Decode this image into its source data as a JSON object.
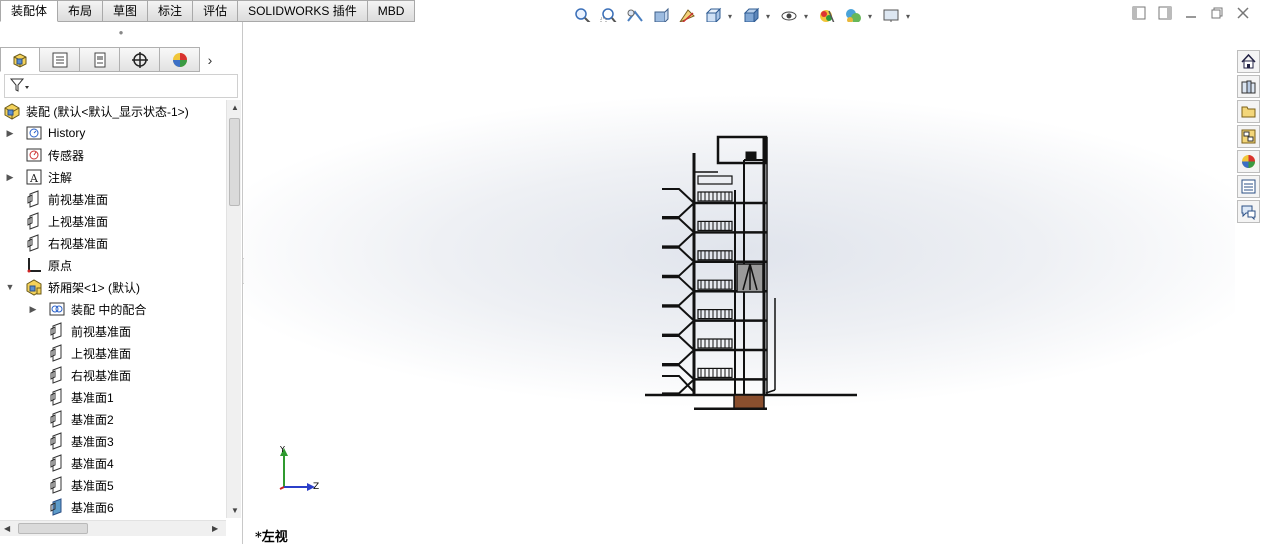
{
  "command_tabs": [
    {
      "label": "装配体",
      "active": true
    },
    {
      "label": "布局",
      "active": false
    },
    {
      "label": "草图",
      "active": false
    },
    {
      "label": "标注",
      "active": false
    },
    {
      "label": "评估",
      "active": false
    },
    {
      "label": "SOLIDWORKS 插件",
      "active": false
    },
    {
      "label": "MBD",
      "active": false
    }
  ],
  "hud_icons": [
    "zoom-to-fit-icon",
    "zoom-to-area-icon",
    "previous-view-icon",
    "section-view-icon",
    "dynamic-annotation-icon",
    "view-orientation-icon",
    "display-style-icon",
    "hide-show-icon",
    "edit-appearance-icon",
    "apply-scene-icon",
    "view-settings-icon"
  ],
  "panel_tabs": [
    "feature-manager-icon",
    "property-manager-icon",
    "configuration-manager-icon",
    "dimxpert-manager-icon",
    "display-manager-icon"
  ],
  "tree": {
    "root": "装配 (默认<默认_显示状态-1>)",
    "items": [
      {
        "label": "History",
        "icon": "history-icon",
        "indent": 1,
        "expand": "▶"
      },
      {
        "label": "传感器",
        "icon": "sensor-icon",
        "indent": 1,
        "expand": ""
      },
      {
        "label": "注解",
        "icon": "annotation-icon",
        "indent": 1,
        "expand": "▶"
      },
      {
        "label": "前视基准面",
        "icon": "plane-icon",
        "indent": 1,
        "expand": ""
      },
      {
        "label": "上视基准面",
        "icon": "plane-icon",
        "indent": 1,
        "expand": ""
      },
      {
        "label": "右视基准面",
        "icon": "plane-icon",
        "indent": 1,
        "expand": ""
      },
      {
        "label": "原点",
        "icon": "origin-icon",
        "indent": 1,
        "expand": ""
      },
      {
        "label": "轿厢架<1> (默认)",
        "icon": "subassembly-icon",
        "indent": 1,
        "expand": "▼"
      },
      {
        "label": "装配 中的配合",
        "icon": "mates-icon",
        "indent": 2,
        "expand": "▶"
      },
      {
        "label": "前视基准面",
        "icon": "plane-icon",
        "indent": 2,
        "expand": ""
      },
      {
        "label": "上视基准面",
        "icon": "plane-icon",
        "indent": 2,
        "expand": ""
      },
      {
        "label": "右视基准面",
        "icon": "plane-icon",
        "indent": 2,
        "expand": ""
      },
      {
        "label": "基准面1",
        "icon": "plane-icon",
        "indent": 2,
        "expand": ""
      },
      {
        "label": "基准面2",
        "icon": "plane-icon",
        "indent": 2,
        "expand": ""
      },
      {
        "label": "基准面3",
        "icon": "plane-icon",
        "indent": 2,
        "expand": ""
      },
      {
        "label": "基准面4",
        "icon": "plane-icon",
        "indent": 2,
        "expand": ""
      },
      {
        "label": "基准面5",
        "icon": "plane-icon",
        "indent": 2,
        "expand": ""
      },
      {
        "label": "基准面6",
        "icon": "plane-selected-icon",
        "indent": 2,
        "expand": ""
      }
    ]
  },
  "graphics": {
    "view_label": "*左视",
    "triad": {
      "y": "Y",
      "z": "Z"
    },
    "floors": 7
  },
  "task_pane": [
    "home-icon",
    "design-library-icon",
    "file-explorer-icon",
    "view-palette-icon",
    "appearances-icon",
    "custom-properties-icon",
    "forum-icon"
  ],
  "colors": {
    "accent_blue": "#2b62c9",
    "model_line": "#111111",
    "pit_brown": "#8a4f2e"
  }
}
